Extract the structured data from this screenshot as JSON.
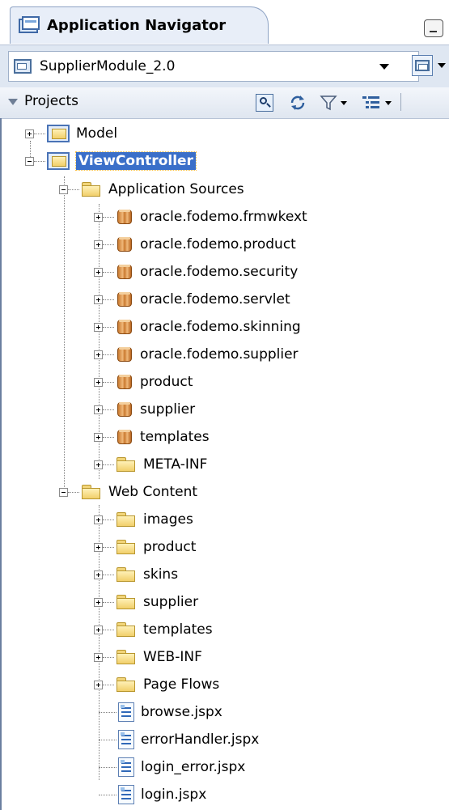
{
  "navigator": {
    "title": "Application Navigator",
    "application": "SupplierModule_2.0"
  },
  "projects_header": {
    "label": "Projects",
    "toolbar_icons": [
      "search-icon",
      "sync-icon",
      "filter-icon",
      "tree-options-icon"
    ]
  },
  "tree": {
    "model": "Model",
    "view_controller": "ViewController",
    "application_sources": {
      "label": "Application Sources",
      "items": [
        {
          "label": "oracle.fodemo.frmwkext",
          "icon": "package"
        },
        {
          "label": "oracle.fodemo.product",
          "icon": "package"
        },
        {
          "label": "oracle.fodemo.security",
          "icon": "package"
        },
        {
          "label": "oracle.fodemo.servlet",
          "icon": "package"
        },
        {
          "label": "oracle.fodemo.skinning",
          "icon": "package"
        },
        {
          "label": "oracle.fodemo.supplier",
          "icon": "package"
        },
        {
          "label": "product",
          "icon": "package"
        },
        {
          "label": "supplier",
          "icon": "package"
        },
        {
          "label": "templates",
          "icon": "package"
        },
        {
          "label": "META-INF",
          "icon": "folder"
        }
      ]
    },
    "web_content": {
      "label": "Web Content",
      "folders": [
        "images",
        "product",
        "skins",
        "supplier",
        "templates",
        "WEB-INF",
        "Page Flows"
      ],
      "files": [
        "browse.jspx",
        "errorHandler.jspx",
        "login_error.jspx",
        "login.jspx"
      ]
    }
  },
  "colors": {
    "selection": "#3a6fc9",
    "header_bg": "#dfe7f2",
    "folder": "#f1cf6a"
  }
}
